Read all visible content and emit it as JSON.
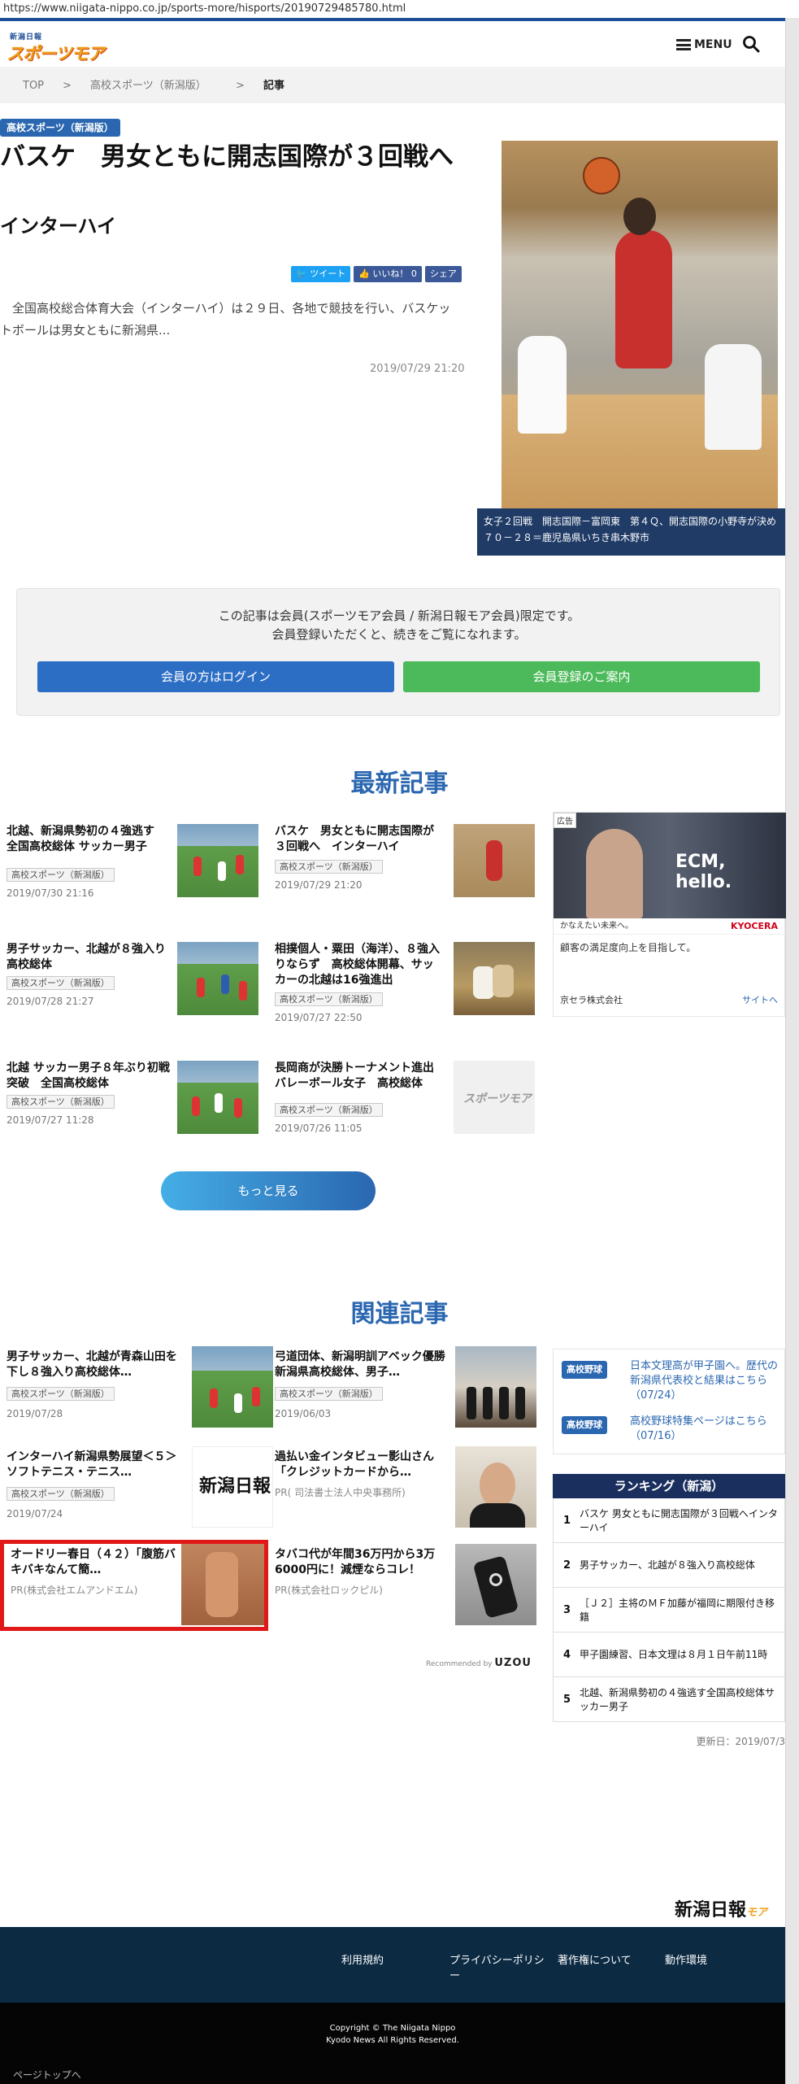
{
  "url": "https://www.niigata-nippo.co.jp/sports-more/hisports/20190729485780.html",
  "header": {
    "logo_small": "新潟日報",
    "logo_main": "スポーツモア",
    "menu_label": "MENU"
  },
  "breadcrumb": {
    "top": "TOP",
    "sep1": ">",
    "cat": "高校スポーツ（新潟版）",
    "sep2": ">",
    "current": "記事"
  },
  "article": {
    "category": "高校スポーツ（新潟版）",
    "title": "バスケ　男女ともに開志国際が３回戦へ",
    "subtitle": "インターハイ",
    "tweet": "ツイート",
    "like": "いいね！ 0",
    "share": "シェア",
    "excerpt": "全国高校総合体育大会（インターハイ）は２９日、各地で競技を行い、バスケットボールは男女ともに新潟県...",
    "date": "2019/07/29 21:20",
    "caption": "女子２回戦　開志国際－富岡東　第４Ｑ、開志国際の小野寺が決め７０－２８＝鹿児島県いちき串木野市"
  },
  "member": {
    "line1": "この記事は会員(スポーツモア会員 / 新潟日報モア会員)限定です。",
    "line2": "会員登録いただくと、続きをご覧になれます。",
    "login": "会員の方はログイン",
    "register": "会員登録のご案内"
  },
  "latest": {
    "heading": "最新記事",
    "items": [
      {
        "title": "北越、新潟県勢初の４強逃す　全国高校総体 サッカー男子",
        "cat": "高校スポーツ（新潟版）",
        "date": "2019/07/30 21:16"
      },
      {
        "title": "バスケ　男女ともに開志国際が３回戦へ　インターハイ",
        "cat": "高校スポーツ（新潟版）",
        "date": "2019/07/29 21:20"
      },
      {
        "title": "男子サッカー、北越が８強入り　高校総体",
        "cat": "高校スポーツ（新潟版）",
        "date": "2019/07/28 21:27"
      },
      {
        "title": "相撲個人・粟田（海洋）、８強入りならず　高校総体開幕、サッカーの北越は16強進出",
        "cat": "高校スポーツ（新潟版）",
        "date": "2019/07/27 22:50"
      },
      {
        "title": "北越 サッカー男子８年ぶり初戦突破　全国高校総体",
        "cat": "高校スポーツ（新潟版）",
        "date": "2019/07/27 11:28"
      },
      {
        "title": "長岡商が決勝トーナメント進出　バレーボール女子　高校総体",
        "cat": "高校スポーツ（新潟版）",
        "date": "2019/07/26 11:05"
      }
    ],
    "thumb_logo": "スポーツモア",
    "more": "もっと見る"
  },
  "ad": {
    "tag": "広告",
    "headline": "ECM, hello.",
    "bar_text": "かなえたい未来へ。",
    "brand": "KYOCERA",
    "text": "顧客の満足度向上を目指して。",
    "company": "京セラ株式会社",
    "site": "サイトへ"
  },
  "related": {
    "heading": "関連記事",
    "items": [
      {
        "title": "男子サッカー、北越が青森山田を下し８強入り高校総体…",
        "cat": "高校スポーツ（新潟版）",
        "date": "2019/07/28"
      },
      {
        "title": "弓道団体、新潟明訓アベック優勝新潟県高校総体、男子…",
        "cat": "高校スポーツ（新潟版）",
        "date": "2019/06/03"
      },
      {
        "title": "インターハイ新潟県勢展望＜５＞ソフトテニス・テニス…",
        "cat": "高校スポーツ（新潟版）",
        "date": "2019/07/24"
      },
      {
        "title": "過払い金インタビュー影山さん「クレジットカードから…",
        "pr": "PR( 司法書士法人中央事務所)"
      },
      {
        "title": "オードリー春日（４２）「腹筋バキバキなんて簡…",
        "pr": "PR(株式会社エムアンドエム)"
      },
      {
        "title": "タバコ代が年間36万円から3万6000円に！減煙ならコレ！",
        "pr": "PR(株式会社ロックピル)"
      }
    ],
    "nippo_thumb": "新潟日報",
    "recommended": "Recommended by",
    "uzou": "UZOU"
  },
  "side_links": [
    {
      "tag": "高校野球",
      "text": "日本文理高が甲子園へ。歴代の新潟県代表校と結果はこちら（07/24）"
    },
    {
      "tag": "高校野球",
      "text": "高校野球特集ページはこちら（07/16）"
    }
  ],
  "ranking": {
    "heading": "ランキング（新潟）",
    "items": [
      {
        "n": "1",
        "text": "バスケ 男女ともに開志国際が３回戦へインターハイ"
      },
      {
        "n": "2",
        "text": "男子サッカー、北越が８強入り高校総体"
      },
      {
        "n": "3",
        "text": "［Ｊ２］主将のＭＦ加藤が福岡に期限付き移籍"
      },
      {
        "n": "4",
        "text": "甲子園練習、日本文理は８月１日午前11時"
      },
      {
        "n": "5",
        "text": "北越、新潟県勢初の４強逃す全国高校総体サッカー男子"
      }
    ],
    "updated": "更新日：2019/07/3"
  },
  "footer": {
    "logo": "新潟日報",
    "logo_sub": "モア",
    "links": [
      "利用規約",
      "プライバシーポリシー",
      "著作権について",
      "動作環境"
    ],
    "copy1": "Copyright © The Niigata Nippo",
    "copy2": "Kyodo News All Rights Reserved.",
    "pagetop": "ページトップへ"
  }
}
